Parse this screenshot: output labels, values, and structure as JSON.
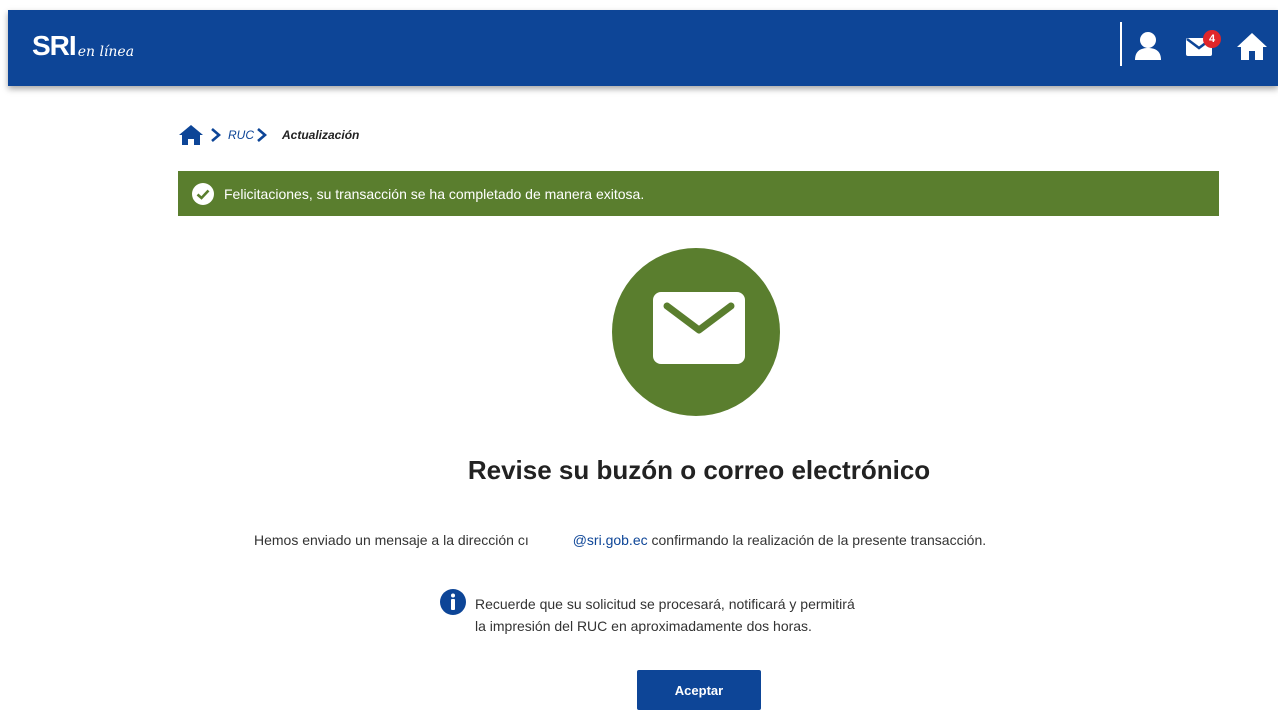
{
  "header": {
    "logo_main": "SRI",
    "logo_script": "en línea",
    "icons": [
      "user-icon",
      "mail-icon",
      "home-icon"
    ],
    "mail_badge_count": "4",
    "bar_color": "#0d4597"
  },
  "breadcrumb": {
    "home_icon": "home-icon",
    "items": [
      "RUC",
      "Actualización"
    ]
  },
  "alert": {
    "icon": "check-circle-icon",
    "text": "Felicitaciones, su transacción se ha completado de manera exitosa.",
    "color": "#5a7e2e"
  },
  "main": {
    "envelope_icon": "envelope-icon",
    "title": "Revise su buzón o correo electrónico",
    "message_prefix": "Hemos enviado un mensaje a la dirección cı",
    "message_email": "@sri.gob.ec",
    "message_suffix": " confirmando la realización de la presente transacción.",
    "info_icon": "info-icon",
    "info_line1": "Recuerde que su solicitud se procesará, notificará y permitirá",
    "info_line2": "la impresión del RUC en aproximadamente dos horas.",
    "accept_label": "Aceptar"
  }
}
